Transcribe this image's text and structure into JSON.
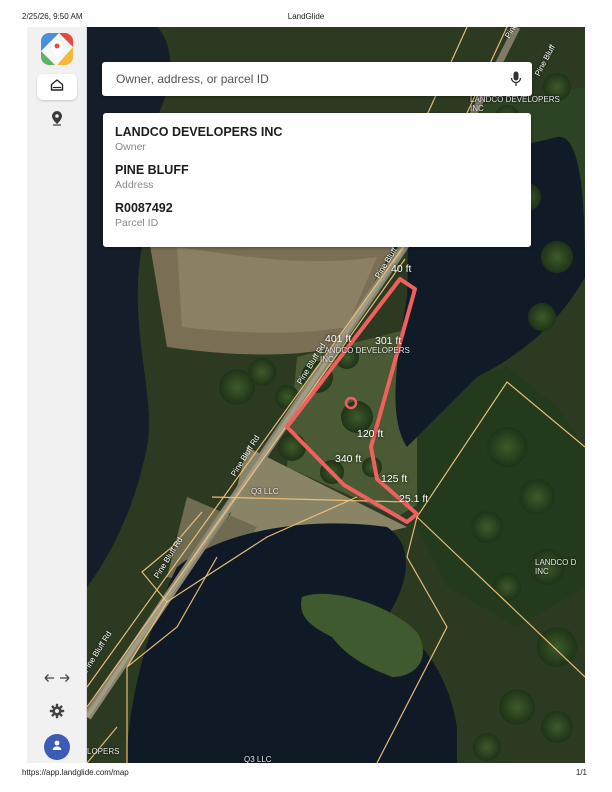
{
  "print": {
    "timestamp": "2/25/26, 9:50 AM",
    "page_title": "LandGlide",
    "url": "https://app.landglide.com/map",
    "page_number": "1/1"
  },
  "sidebar": {
    "items": [
      {
        "icon": "home-icon",
        "active": true
      },
      {
        "icon": "location-pin-icon",
        "active": false
      },
      {
        "icon": "expand-arrows-icon",
        "active": false
      },
      {
        "icon": "gear-icon",
        "active": false
      },
      {
        "icon": "user-icon",
        "active": false
      }
    ]
  },
  "search": {
    "placeholder": "Owner, address, or parcel ID",
    "value": ""
  },
  "parcel": {
    "owner": "LANDCO DEVELOPERS INC",
    "owner_label": "Owner",
    "address": "PINE BLUFF",
    "address_label": "Address",
    "parcel_id": "R0087492",
    "parcel_id_label": "Parcel ID"
  },
  "map": {
    "roads": [
      "Pine Bluff",
      "Pine Bluff Rd",
      "Pine Bluff Rd",
      "Pine Bluff Rd",
      "Pine Bluff Rd",
      "Pine Bluff Rd",
      "Pine Bluff Rd"
    ],
    "owner_labels": [
      {
        "line1": "LANDCO DEVELOPERS",
        "line2": "INC"
      },
      {
        "line1": "LANDCO D",
        "line2": "INC"
      },
      {
        "line1": "LANDCO DEVELOPERS",
        "line2": "INC"
      },
      {
        "line1": "Q3 LLC",
        "line2": ""
      },
      {
        "line1": "LOPERS",
        "line2": ""
      },
      {
        "line1": "Q3 LLC",
        "line2": ""
      }
    ],
    "measurements": [
      "40 ft",
      "301 ft",
      "401 ft",
      "120 ft",
      "340 ft",
      "125 ft",
      "25.1 ft"
    ],
    "colors": {
      "parcel_outline": "#f0605f",
      "parcel_lines": "#f2c27c"
    }
  }
}
